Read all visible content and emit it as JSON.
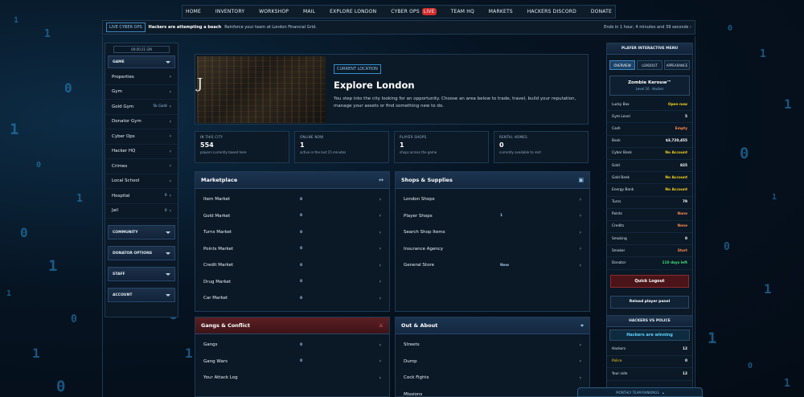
{
  "nav": {
    "items": [
      "HOME",
      "INVENTORY",
      "WORKSHOP",
      "MAIL",
      "EXPLORE LONDON",
      "CYBER OPS",
      "TEAM HQ",
      "MARKETS",
      "HACKERS DISCORD",
      "DONATE"
    ],
    "live_badge": "LIVE"
  },
  "ticker": {
    "tag": "LIVE CYBER OPS",
    "bold": "Hackers are attempting a beach",
    "msg": "Reinforce your team at London Financial Grid.",
    "ends": "Ends in 1 hour, 4 minutes and 39 seconds"
  },
  "sidebar": {
    "clock": "00:00:21 GM",
    "game": "GAME",
    "items": [
      {
        "label": "Properties",
        "extra": ""
      },
      {
        "label": "Gym",
        "extra": ""
      },
      {
        "label": "Gold Gym",
        "extra": "5k Gold"
      },
      {
        "label": "Donator Gym",
        "extra": ""
      },
      {
        "label": "Cyber Ops",
        "extra": ""
      },
      {
        "label": "Hacker HQ",
        "extra": ""
      },
      {
        "label": "Crimes",
        "extra": ""
      },
      {
        "label": "Local School",
        "extra": ""
      },
      {
        "label": "Hospital",
        "extra": "0"
      },
      {
        "label": "Jail",
        "extra": "0"
      }
    ],
    "sections": [
      "COMMUNITY",
      "DONATOR OPTIONS",
      "STAFF",
      "ACCOUNT"
    ]
  },
  "hero": {
    "location_tag": "CURRENT LOCATION",
    "title": "Explore London",
    "desc": "You step into the city looking for an opportunity. Choose an area below to trade, travel, build your reputation, manage your assets or find something new to do."
  },
  "stats": [
    {
      "title": "IN THIS CITY",
      "value": "554",
      "sub": "players currently based here"
    },
    {
      "title": "ONLINE NOW",
      "value": "1",
      "sub": "active in the last 15 minutes"
    },
    {
      "title": "PLAYER SHOPS",
      "value": "1",
      "sub": "shops across the game"
    },
    {
      "title": "RENTAL HOMES",
      "value": "0",
      "sub": "currently available to rent"
    }
  ],
  "marketplace": {
    "title": "Marketplace",
    "rows": [
      {
        "name": "Item Market",
        "val": "0"
      },
      {
        "name": "Gold Market",
        "val": "0"
      },
      {
        "name": "Turns Market",
        "val": "0"
      },
      {
        "name": "Points Market",
        "val": "0"
      },
      {
        "name": "Credit Market",
        "val": "0"
      },
      {
        "name": "Drug Market",
        "val": "0"
      },
      {
        "name": "Car Market",
        "val": "0"
      }
    ]
  },
  "shops": {
    "title": "Shops & Supplies",
    "rows": [
      {
        "name": "London Shops",
        "val": ""
      },
      {
        "name": "Player Shops",
        "val": "1"
      },
      {
        "name": "Search Shop Items",
        "val": ""
      },
      {
        "name": "Insurance Agency",
        "val": ""
      },
      {
        "name": "General Store",
        "val": "New"
      }
    ]
  },
  "gangs": {
    "title": "Gangs & Conflict",
    "rows": [
      {
        "name": "Gangs",
        "val": "0"
      },
      {
        "name": "Gang Wars",
        "val": "0"
      },
      {
        "name": "Your Attack Log",
        "val": ""
      }
    ]
  },
  "out": {
    "title": "Out & About",
    "rows": [
      {
        "name": "Streets",
        "val": ""
      },
      {
        "name": "Dump",
        "val": ""
      },
      {
        "name": "Cock Fights",
        "val": ""
      },
      {
        "name": "Missions",
        "val": ""
      }
    ]
  },
  "player": {
    "header": "PLAYER INTERACTIVE MENU",
    "tabs": [
      "OVERVIEW",
      "LOADOUT",
      "APPEARANCE"
    ],
    "name": "Zombie Kerouw™",
    "level": "Level 16 · Hacker",
    "rows": [
      {
        "k": "Lucky Box",
        "v": "Open now",
        "c": "y"
      },
      {
        "k": "Gym Level",
        "v": "5",
        "c": ""
      },
      {
        "k": "Cash",
        "v": "Empty",
        "c": "o"
      },
      {
        "k": "Bank",
        "v": "$3,720,455",
        "c": ""
      },
      {
        "k": "Cyber Bank",
        "v": "No Account",
        "c": "y"
      },
      {
        "k": "Gold",
        "v": "825",
        "c": ""
      },
      {
        "k": "Gold Bank",
        "v": "No Account",
        "c": "y"
      },
      {
        "k": "Energy Bank",
        "v": "No Account",
        "c": "y"
      },
      {
        "k": "Turns",
        "v": "79",
        "c": ""
      },
      {
        "k": "Points",
        "v": "None",
        "c": "o"
      },
      {
        "k": "Credits",
        "v": "None",
        "c": "o"
      },
      {
        "k": "Smoking",
        "v": "0",
        "c": ""
      },
      {
        "k": "Smoker",
        "v": "Start",
        "c": "o"
      },
      {
        "k": "Donator",
        "v": "110 days left",
        "c": "g"
      }
    ],
    "logout": "Quick Logout",
    "reload": "Reload player panel"
  },
  "hvp": {
    "header": "HACKERS VS POLICE",
    "status": "Hackers are winning",
    "rows": [
      {
        "k": "Hackers",
        "v": "12",
        "c": ""
      },
      {
        "k": "Police",
        "v": "0",
        "c": "y"
      },
      {
        "k": "Your side",
        "v": "12",
        "c": ""
      }
    ]
  },
  "bottom": {
    "label": "MONTHLY TEAM RANKINGS"
  }
}
